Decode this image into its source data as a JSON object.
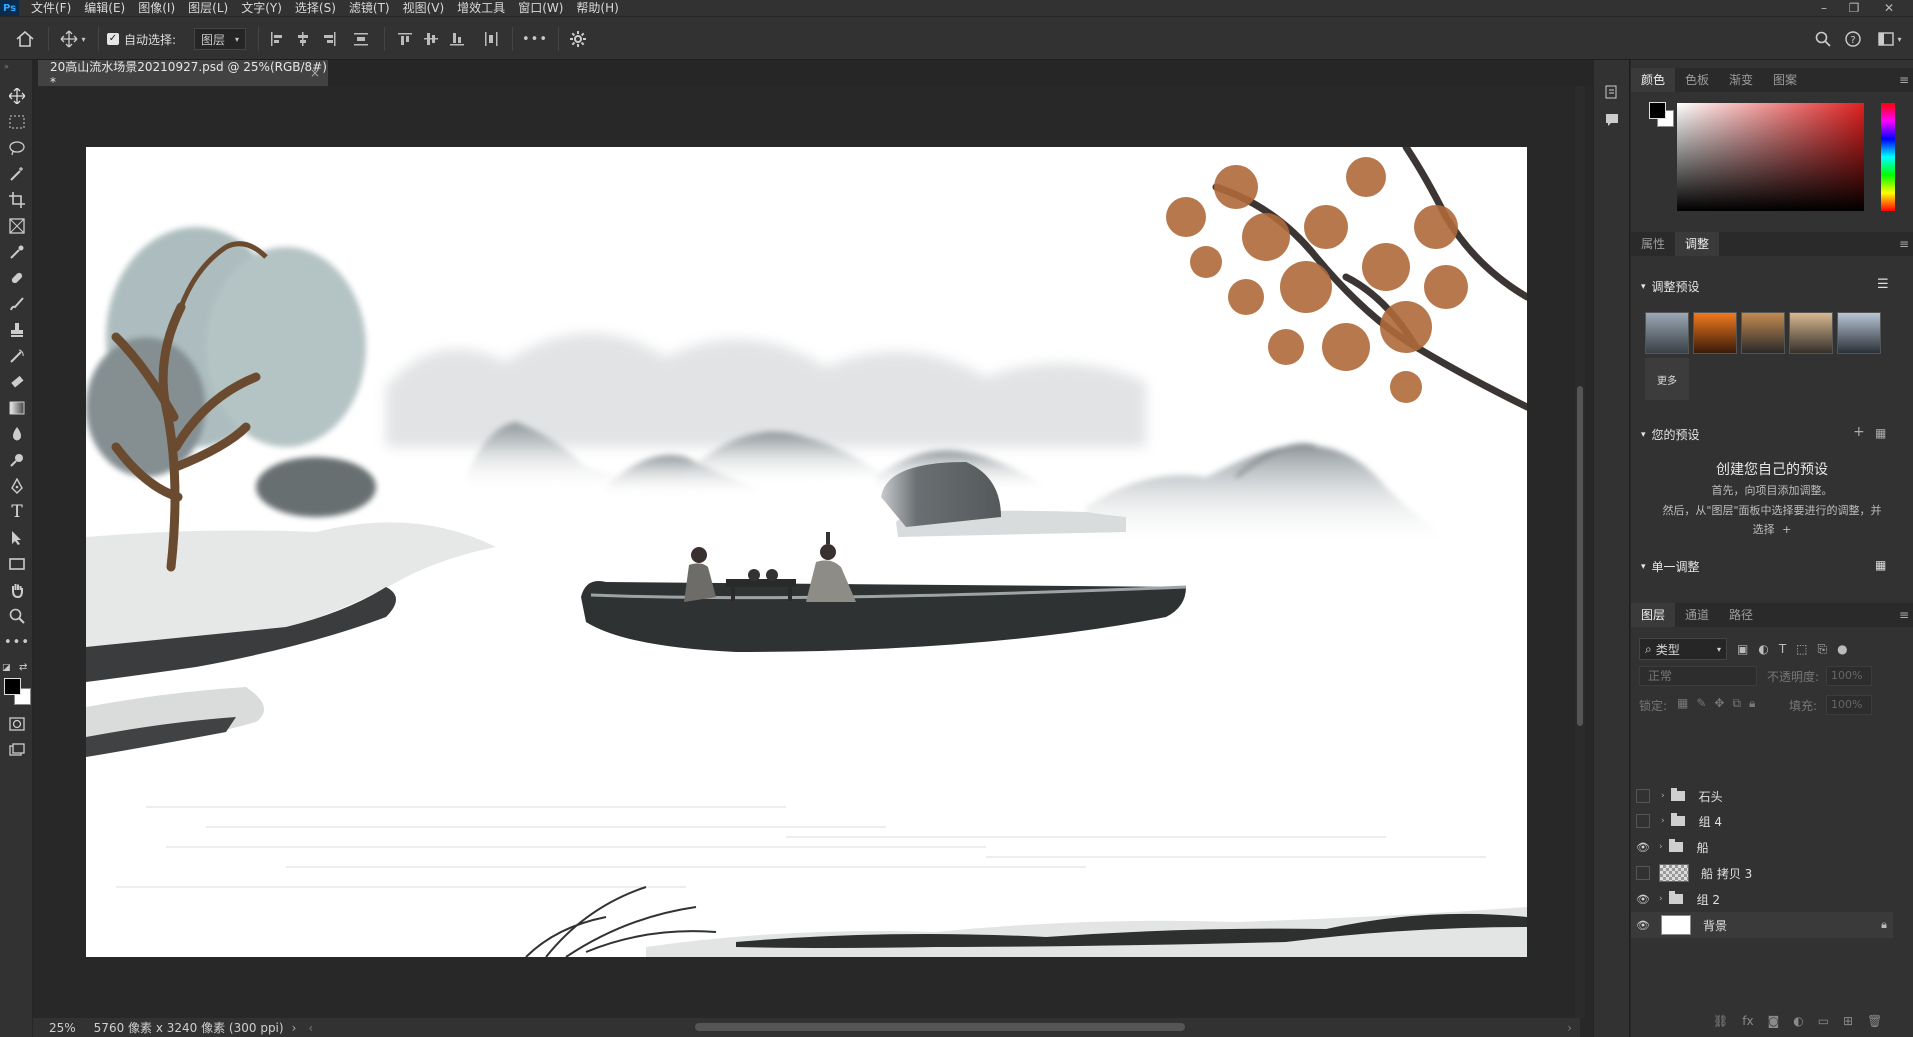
{
  "menubar": {
    "logo": "Ps",
    "items": [
      "文件(F)",
      "编辑(E)",
      "图像(I)",
      "图层(L)",
      "文字(Y)",
      "选择(S)",
      "滤镜(T)",
      "视图(V)",
      "增效工具",
      "窗口(W)",
      "帮助(H)"
    ]
  },
  "options": {
    "auto_select_label": "自动选择:",
    "auto_select_target": "图层",
    "more": "•••"
  },
  "document": {
    "tab_title": "20高山流水场景20210927.psd @ 25%(RGB/8#) *",
    "close": "×"
  },
  "status": {
    "zoom": "25%",
    "info": "5760 像素 x 3240 像素 (300 ppi)"
  },
  "color_panel": {
    "tabs": [
      "颜色",
      "色板",
      "渐变",
      "图案"
    ],
    "foreground": "#000000",
    "background": "#ffffff",
    "picker_hue": "#e02020"
  },
  "adjust_panel": {
    "tabs": [
      "属性",
      "调整"
    ],
    "presets_title": "调整预设",
    "more_label": "更多",
    "your_presets_title": "您的预设",
    "create_title": "创建您自己的预设",
    "create_line1": "首先，向项目添加调整。",
    "create_line2": "然后，从\"图层\"面板中选择要进行的调整，并",
    "create_line3": "选择",
    "single_title": "单一调整"
  },
  "layers_panel": {
    "tabs": [
      "图层",
      "通道",
      "路径"
    ],
    "filter_label": "类型",
    "blend_mode": "正常",
    "opacity_label": "不透明度:",
    "opacity_value": "100%",
    "lock_label": "锁定:",
    "fill_label": "填充:",
    "fill_value": "100%",
    "layers": [
      {
        "name": "石头",
        "type": "group",
        "visible": false
      },
      {
        "name": "组 4",
        "type": "group",
        "visible": false
      },
      {
        "name": "船",
        "type": "group",
        "visible": true
      },
      {
        "name": "船 拷贝 3",
        "type": "layer",
        "visible": false
      },
      {
        "name": "组 2",
        "type": "group",
        "visible": true
      },
      {
        "name": "背景",
        "type": "background",
        "visible": true
      }
    ]
  },
  "colors": {
    "ui_bg": "#323232",
    "canvas_bg": "#282828",
    "accent": "#31a8ff",
    "leaf": "#b06a3a"
  }
}
